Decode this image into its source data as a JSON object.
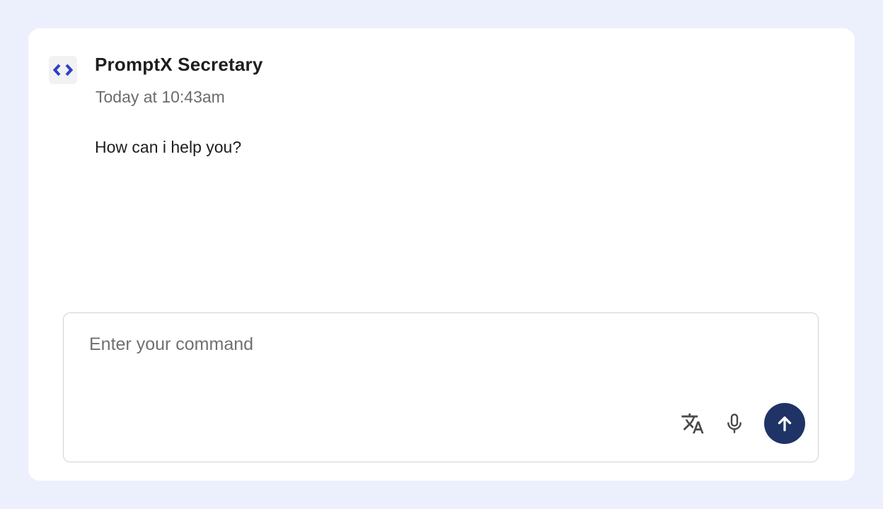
{
  "chat": {
    "sender_name": "PromptX Secretary",
    "timestamp": "Today at 10:43am",
    "message": "How can i help you?"
  },
  "composer": {
    "placeholder": "Enter your command",
    "value": ""
  },
  "icons": {
    "avatar": "chevrons-logo-icon",
    "translate": "translate-icon",
    "microphone": "microphone-icon",
    "send": "arrow-up-icon"
  },
  "colors": {
    "page_background": "#ECEFFC",
    "send_button": "#1F3366",
    "logo_accent": "#2E3FC8"
  }
}
